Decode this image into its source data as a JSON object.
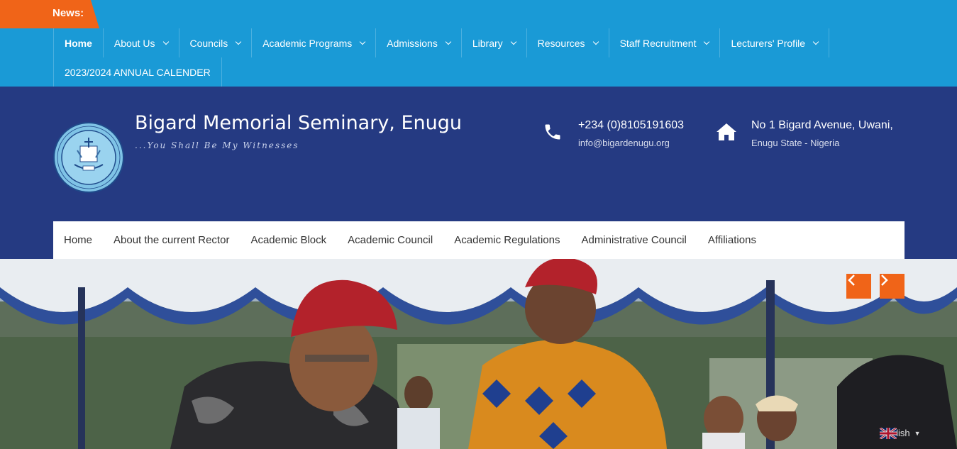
{
  "news": {
    "label": "News:"
  },
  "top_nav": {
    "row1": [
      {
        "label": "Home",
        "active": true,
        "dropdown": false
      },
      {
        "label": "About Us",
        "dropdown": true
      },
      {
        "label": "Councils",
        "dropdown": true
      },
      {
        "label": "Academic Programs",
        "dropdown": true
      },
      {
        "label": "Admissions",
        "dropdown": true
      },
      {
        "label": "Library",
        "dropdown": true
      },
      {
        "label": "Resources",
        "dropdown": true
      },
      {
        "label": "Staff Recruitment",
        "dropdown": true
      },
      {
        "label": "Lecturers' Profile",
        "dropdown": true
      }
    ],
    "row2": [
      {
        "label": "2023/2024 ANNUAL CALENDER",
        "dropdown": false
      }
    ]
  },
  "header": {
    "site_title": "Bigard Memorial Seminary, Enugu",
    "tagline": "...You Shall Be My Witnesses",
    "phone": {
      "number": "+234 (0)8105191603",
      "email": "info@bigardenugu.org",
      "icon": "phone-icon"
    },
    "address": {
      "line1": "No 1 Bigard Avenue, Uwani,",
      "line2": "Enugu State - Nigeria",
      "icon": "home-icon"
    }
  },
  "sub_nav": [
    "Home",
    "About the current Rector",
    "Academic Block",
    "Academic Council",
    "Academic Regulations",
    "Administrative Council",
    "Affiliations"
  ],
  "slider": {
    "prev_icon": "chevron-left-icon",
    "next_icon": "chevron-right-icon"
  },
  "language": {
    "label": "English"
  },
  "colors": {
    "topbar": "#1a9ad6",
    "header": "#253a82",
    "accent": "#f06418"
  }
}
